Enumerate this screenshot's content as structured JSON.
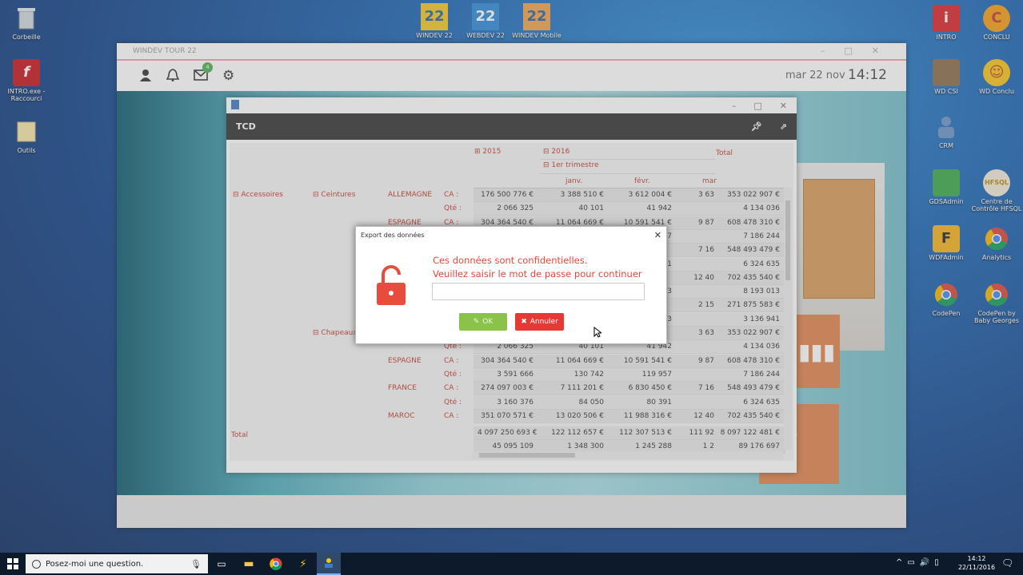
{
  "desktop": {
    "icons_left": [
      {
        "label": "Corbeille",
        "icon": "recycle-bin-icon"
      },
      {
        "label": "INTRO.exe - Raccourci",
        "icon": "flash-icon"
      },
      {
        "label": "Outils",
        "icon": "folder-icon"
      }
    ],
    "icons_top": [
      {
        "label": "WINDEV 22",
        "icon": "windev-icon"
      },
      {
        "label": "WEBDEV 22",
        "icon": "webdev-icon"
      },
      {
        "label": "WINDEV Mobile",
        "icon": "windev-mobile-icon"
      }
    ],
    "icons_right": [
      {
        "label": "INTRO",
        "icon": "intro-icon"
      },
      {
        "label": "CONCLU",
        "icon": "conclu-icon"
      },
      {
        "label": "WD CSI",
        "icon": "wd-csi-icon"
      },
      {
        "label": "WD Conclu",
        "icon": "emoji-icon"
      },
      {
        "label": "CRM",
        "icon": "crm-icon"
      },
      {
        "label": "GDSAdmin",
        "icon": "gds-icon"
      },
      {
        "label": "Centre de Contrôle HFSQL",
        "icon": "hfsql-icon"
      },
      {
        "label": "WDFAdmin",
        "icon": "wdf-icon"
      },
      {
        "label": "Analytics",
        "icon": "chrome-icon"
      },
      {
        "label": "CodePen",
        "icon": "chrome-icon"
      },
      {
        "label": "CodePen by Baby Georges",
        "icon": "chrome-icon"
      }
    ]
  },
  "main_window": {
    "title": "WINDEV TOUR 22",
    "mail_badge": "4",
    "date": "mar 22 nov",
    "time": "14:12"
  },
  "tcd": {
    "title": "TCD",
    "headers": {
      "y2015": "2015",
      "y2016": "2016",
      "total": "Total",
      "quarter": "1er trimestre",
      "jan": "janv.",
      "feb": "févr.",
      "mar": "mar"
    },
    "row_labels": {
      "cat": "Accessoires",
      "sub1": "Ceintures",
      "sub2": "Chapeaux",
      "total": "Total"
    },
    "rows": [
      {
        "country": "ALLEMAGNE",
        "measure": "CA :",
        "v2015": "176 500 776 €",
        "jan": "3 388 510 €",
        "feb": "3 612 004 €",
        "mar": "3 63",
        "total": "353 022 907 €"
      },
      {
        "country": "",
        "measure": "Qté :",
        "v2015": "2 066 325",
        "jan": "40 101",
        "feb": "41 942",
        "mar": "",
        "total": "4 134 036"
      },
      {
        "country": "ESPAGNE",
        "measure": "CA :",
        "v2015": "304 364 540 €",
        "jan": "11 064 669 €",
        "feb": "10 591 541 €",
        "mar": "9 87",
        "total": "608 478 310 €"
      },
      {
        "country": "",
        "measure": "",
        "v2015": "",
        "jan": "",
        "feb": "7",
        "mar": "",
        "total": "7 186 244"
      },
      {
        "country": "",
        "measure": "",
        "v2015": "",
        "jan": "",
        "feb": "",
        "mar": "7 16",
        "total": "548 493 479 €"
      },
      {
        "country": "",
        "measure": "",
        "v2015": "",
        "jan": "",
        "feb": "1",
        "mar": "",
        "total": "6 324 635"
      },
      {
        "country": "",
        "measure": "",
        "v2015": "",
        "jan": "",
        "feb": "",
        "mar": "12 40",
        "total": "702 435 540 €"
      },
      {
        "country": "",
        "measure": "",
        "v2015": "",
        "jan": "",
        "feb": "3",
        "mar": "",
        "total": "8 193 013"
      },
      {
        "country": "",
        "measure": "",
        "v2015": "",
        "jan": "",
        "feb": "",
        "mar": "2 15",
        "total": "271 875 583 €"
      },
      {
        "country": "",
        "measure": "",
        "v2015": "",
        "jan": "",
        "feb": "3",
        "mar": "",
        "total": "3 136 941"
      },
      {
        "country": "",
        "measure": "",
        "v2015": "",
        "jan": "",
        "feb": "",
        "mar": "3 63",
        "total": "353 022 907 €"
      },
      {
        "country": "",
        "measure": "Qté :",
        "v2015": "2 066 325",
        "jan": "40 101",
        "feb": "41 942",
        "mar": "",
        "total": "4 134 036"
      },
      {
        "country": "ESPAGNE",
        "measure": "CA :",
        "v2015": "304 364 540 €",
        "jan": "11 064 669 €",
        "feb": "10 591 541 €",
        "mar": "9 87",
        "total": "608 478 310 €"
      },
      {
        "country": "",
        "measure": "Qté :",
        "v2015": "3 591 666",
        "jan": "130 742",
        "feb": "119 957",
        "mar": "",
        "total": "7 186 244"
      },
      {
        "country": "FRANCE",
        "measure": "CA :",
        "v2015": "274 097 003 €",
        "jan": "7 111 201 €",
        "feb": "6 830 450 €",
        "mar": "7 16",
        "total": "548 493 479 €"
      },
      {
        "country": "",
        "measure": "Qté :",
        "v2015": "3 160 376",
        "jan": "84 050",
        "feb": "80 391",
        "mar": "",
        "total": "6 324 635"
      },
      {
        "country": "MAROC",
        "measure": "CA :",
        "v2015": "351 070 571 €",
        "jan": "13 020 506 €",
        "feb": "11 988 316 €",
        "mar": "12 40",
        "total": "702 435 540 €"
      }
    ],
    "total_row": [
      {
        "v2015": "4 097 250 693 €",
        "jan": "122 112 657 €",
        "feb": "112 307 513 €",
        "mar": "111 92",
        "total": "8 097 122 481 €"
      },
      {
        "v2015": "45 095 109",
        "jan": "1 348 300",
        "feb": "1 245 288",
        "mar": "1 2",
        "total": "89 176 697"
      }
    ]
  },
  "dialog": {
    "title": "Export des données",
    "line1": "Ces données sont confidentielles.",
    "line2": "Veuillez saisir le mot de passe pour continuer",
    "password_value": "",
    "ok": "OK",
    "cancel": "Annuler"
  },
  "taskbar": {
    "search_placeholder": "Posez-moi une question.",
    "clock_time": "14:12",
    "clock_date": "22/11/2016"
  }
}
